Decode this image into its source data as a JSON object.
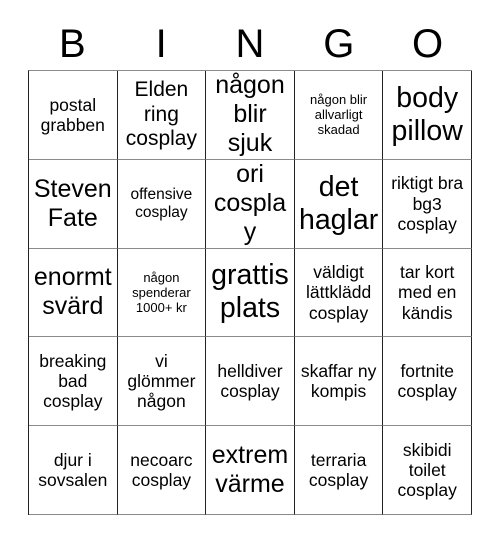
{
  "card": {
    "title": "BINGO",
    "header_letters": [
      "B",
      "I",
      "N",
      "G",
      "O"
    ],
    "columns": 5,
    "rows": 5,
    "colors": {
      "background": "#ffffff",
      "text": "#000000",
      "grid_line_dark": "#222222",
      "grid_line_light": "#8a8a8a"
    },
    "cells": [
      {
        "text": "postal grabben",
        "size": "fs-md"
      },
      {
        "text": "Elden ring cosplay",
        "size": "fs-lg"
      },
      {
        "text": "någon blir sjuk",
        "size": "fs-xl"
      },
      {
        "text": "någon blir allvarligt skadad",
        "size": "fs-xs"
      },
      {
        "text": "body pillow",
        "size": "fs-xxl"
      },
      {
        "text": "Steven Fate",
        "size": "fs-xl"
      },
      {
        "text": "offensive cosplay",
        "size": "fs-sm"
      },
      {
        "text": "ori cosplay",
        "size": "fs-xl"
      },
      {
        "text": "det haglar",
        "size": "fs-xxl"
      },
      {
        "text": "riktigt bra bg3 cosplay",
        "size": "fs-md"
      },
      {
        "text": "enormt svärd",
        "size": "fs-xl"
      },
      {
        "text": "någon spenderar 1000+ kr",
        "size": "fs-xs"
      },
      {
        "text": "grattis plats",
        "size": "fs-xxl"
      },
      {
        "text": "väldigt lättklädd cosplay",
        "size": "fs-md"
      },
      {
        "text": "tar kort med en kändis",
        "size": "fs-md"
      },
      {
        "text": "breaking bad cosplay",
        "size": "fs-md"
      },
      {
        "text": "vi glömmer någon",
        "size": "fs-md"
      },
      {
        "text": "helldiver cosplay",
        "size": "fs-md"
      },
      {
        "text": "skaffar ny kompis",
        "size": "fs-md"
      },
      {
        "text": "fortnite cosplay",
        "size": "fs-md"
      },
      {
        "text": "djur i sovsalen",
        "size": "fs-md"
      },
      {
        "text": "necoarc cosplay",
        "size": "fs-md"
      },
      {
        "text": "extrem värme",
        "size": "fs-xl"
      },
      {
        "text": "terraria cosplay",
        "size": "fs-md"
      },
      {
        "text": "skibidi toilet cosplay",
        "size": "fs-md"
      }
    ]
  }
}
